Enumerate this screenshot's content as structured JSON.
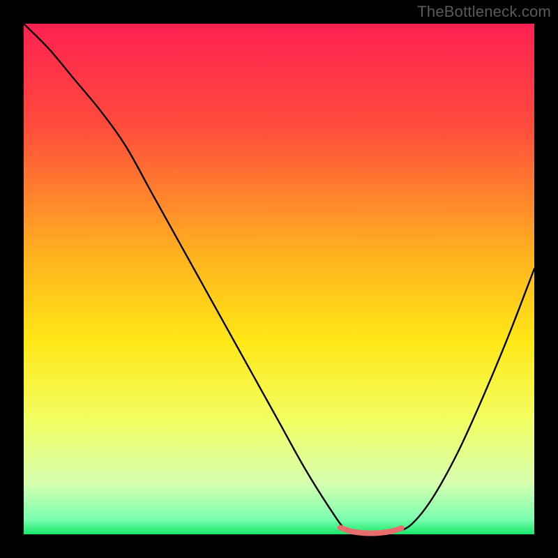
{
  "watermark": "TheBottleneck.com",
  "chart_data": {
    "type": "line",
    "title": "",
    "xlabel": "",
    "ylabel": "",
    "xlim": [
      0,
      100
    ],
    "ylim": [
      0,
      100
    ],
    "grid": false,
    "legend": false,
    "gradient_stops": [
      {
        "offset": 0,
        "color": "#ff2152"
      },
      {
        "offset": 20,
        "color": "#ff4b3c"
      },
      {
        "offset": 45,
        "color": "#ffb11f"
      },
      {
        "offset": 62,
        "color": "#ffe716"
      },
      {
        "offset": 78,
        "color": "#f2ff64"
      },
      {
        "offset": 90,
        "color": "#d6ffb0"
      },
      {
        "offset": 97,
        "color": "#7cffb0"
      },
      {
        "offset": 100,
        "color": "#17e86a"
      }
    ],
    "series": [
      {
        "name": "bottleneck-curve",
        "stroke": "#000000",
        "x": [
          0,
          5,
          10,
          15,
          20,
          25,
          30,
          35,
          40,
          45,
          50,
          55,
          60,
          63,
          66,
          70,
          73,
          76,
          80,
          85,
          90,
          95,
          100
        ],
        "y": [
          100,
          95,
          89,
          83,
          76,
          67,
          58,
          49,
          40,
          31,
          22,
          13,
          5,
          1,
          0,
          0,
          0.5,
          2,
          7,
          16,
          27,
          39,
          52
        ]
      },
      {
        "name": "valley-highlight",
        "stroke": "#e86e6e",
        "stroke_width": 8,
        "x": [
          62,
          64,
          66,
          68,
          70,
          72,
          74
        ],
        "y": [
          1.3,
          0.6,
          0.3,
          0.2,
          0.3,
          0.6,
          1.2
        ]
      }
    ]
  }
}
